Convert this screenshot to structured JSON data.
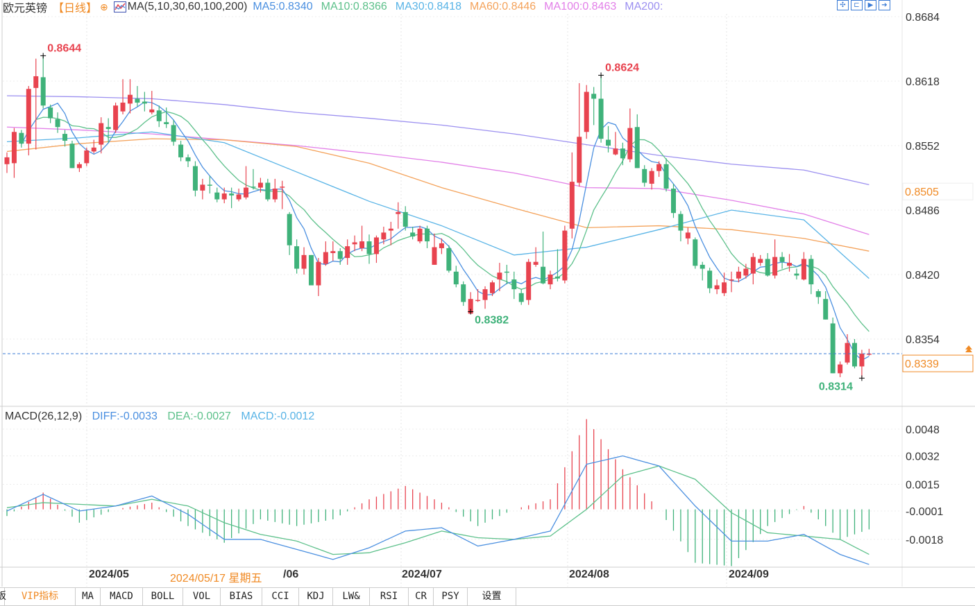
{
  "header": {
    "symbol": "欧元英镑",
    "period": "【日线】",
    "ma_params": "MA(5,10,30,60,100,200)",
    "ma_values": [
      {
        "label": "MA5:0.8340",
        "color": "#4a8fe0"
      },
      {
        "label": "MA10:0.8366",
        "color": "#5cc08a"
      },
      {
        "label": "MA30:0.8418",
        "color": "#57b3e6"
      },
      {
        "label": "MA60:0.8446",
        "color": "#f4a25a"
      },
      {
        "label": "MA100:0.8463",
        "color": "#e27ee8"
      },
      {
        "label": "MA200:",
        "color": "#9b8ff0"
      }
    ]
  },
  "toolbar": [
    "crosshair-icon",
    "zoom-in-icon",
    "play-icon",
    "exit-icon"
  ],
  "macd_header": {
    "title": "MACD(26,12,9)",
    "diff": "DIFF:-0.0033",
    "dea": "DEA:-0.0027",
    "macd": "MACD:-0.0012"
  },
  "x_axis": {
    "labels": [
      "2024/05",
      "/06",
      "2024/07",
      "2024/08",
      "2024/09"
    ],
    "crosshair_date": "2024/05/17 星期五"
  },
  "tabs": [
    "板",
    "VIP指标",
    "MA",
    "MACD",
    "BOLL",
    "VOL",
    "BIAS",
    "CCI",
    "KDJ",
    "LW&",
    "RSI",
    "CR",
    "PSY",
    "设置"
  ],
  "colors": {
    "up": "#e8434f",
    "down": "#3fb27a",
    "last_price_line": "#3a7bd5",
    "accent": "#f08a24"
  },
  "chart_data": [
    {
      "type": "candlestick",
      "y_ticks": [
        "0.8684",
        "0.8618",
        "0.8552",
        "0.8486",
        "0.8420",
        "0.8354"
      ],
      "ylim": [
        0.8284,
        0.8684
      ],
      "crosshair_price": "0.8505",
      "last_price": "0.8339",
      "annotations": [
        {
          "label": "0.8644",
          "index": 5,
          "price": 0.8644,
          "kind": "high"
        },
        {
          "label": "0.8624",
          "index": 82,
          "price": 0.8624,
          "kind": "high"
        },
        {
          "label": "0.8382",
          "index": 64,
          "price": 0.8382,
          "kind": "low"
        },
        {
          "label": "0.8314",
          "index": 118,
          "price": 0.8314,
          "kind": "low"
        }
      ],
      "ohlc": [
        [
          0.8533,
          0.8545,
          0.8524,
          0.854
        ],
        [
          0.8534,
          0.857,
          0.8519,
          0.8566
        ],
        [
          0.8565,
          0.8568,
          0.855,
          0.8554
        ],
        [
          0.8554,
          0.8613,
          0.8542,
          0.861
        ],
        [
          0.8611,
          0.8641,
          0.8548,
          0.8623
        ],
        [
          0.8622,
          0.8644,
          0.859,
          0.8593
        ],
        [
          0.8591,
          0.8594,
          0.8575,
          0.858
        ],
        [
          0.8579,
          0.8586,
          0.8565,
          0.8571
        ],
        [
          0.8564,
          0.8568,
          0.8551,
          0.8557
        ],
        [
          0.8554,
          0.8557,
          0.8529,
          0.8529
        ],
        [
          0.8529,
          0.8535,
          0.8525,
          0.8533
        ],
        [
          0.8534,
          0.855,
          0.8531,
          0.8547
        ],
        [
          0.8546,
          0.8558,
          0.8544,
          0.855
        ],
        [
          0.8553,
          0.8581,
          0.8544,
          0.8575
        ],
        [
          0.8571,
          0.858,
          0.8555,
          0.8569
        ],
        [
          0.8568,
          0.8596,
          0.8565,
          0.8593
        ],
        [
          0.8587,
          0.862,
          0.8584,
          0.8596
        ],
        [
          0.8595,
          0.862,
          0.8585,
          0.8604
        ],
        [
          0.86,
          0.8613,
          0.8592,
          0.8596
        ],
        [
          0.8597,
          0.8607,
          0.8587,
          0.8595
        ],
        [
          0.8586,
          0.8608,
          0.8584,
          0.8589
        ],
        [
          0.8588,
          0.8593,
          0.8571,
          0.8577
        ],
        [
          0.8576,
          0.8591,
          0.857,
          0.8574
        ],
        [
          0.8573,
          0.8578,
          0.8552,
          0.8556
        ],
        [
          0.8553,
          0.8557,
          0.8536,
          0.854
        ],
        [
          0.854,
          0.8543,
          0.853,
          0.8536
        ],
        [
          0.8531,
          0.8536,
          0.85,
          0.8506
        ],
        [
          0.8506,
          0.8518,
          0.8497,
          0.8512
        ],
        [
          0.8512,
          0.8521,
          0.8503,
          0.8511
        ],
        [
          0.8504,
          0.8509,
          0.8494,
          0.8497
        ],
        [
          0.8497,
          0.8509,
          0.8493,
          0.8503
        ],
        [
          0.8503,
          0.8509,
          0.8488,
          0.8501
        ],
        [
          0.8497,
          0.8508,
          0.8495,
          0.8502
        ],
        [
          0.8499,
          0.8531,
          0.8497,
          0.8509
        ],
        [
          0.851,
          0.8528,
          0.8507,
          0.8509
        ],
        [
          0.8509,
          0.8519,
          0.8504,
          0.8514
        ],
        [
          0.8514,
          0.8518,
          0.8495,
          0.8497
        ],
        [
          0.8497,
          0.8518,
          0.8494,
          0.8508
        ],
        [
          0.8509,
          0.8516,
          0.8487,
          0.851
        ],
        [
          0.8482,
          0.8484,
          0.844,
          0.845
        ],
        [
          0.8449,
          0.8456,
          0.8421,
          0.8426
        ],
        [
          0.8426,
          0.8448,
          0.842,
          0.844
        ],
        [
          0.844,
          0.844,
          0.8409,
          0.8409
        ],
        [
          0.8409,
          0.8437,
          0.8398,
          0.8433
        ],
        [
          0.8431,
          0.8454,
          0.8429,
          0.8443
        ],
        [
          0.8442,
          0.8454,
          0.8434,
          0.8444
        ],
        [
          0.8444,
          0.8447,
          0.843,
          0.8436
        ],
        [
          0.8437,
          0.8456,
          0.843,
          0.8449
        ],
        [
          0.8451,
          0.846,
          0.8444,
          0.8453
        ],
        [
          0.8447,
          0.847,
          0.8444,
          0.8454
        ],
        [
          0.8454,
          0.8461,
          0.8431,
          0.8441
        ],
        [
          0.8441,
          0.846,
          0.8432,
          0.8458
        ],
        [
          0.8456,
          0.8469,
          0.8451,
          0.8463
        ],
        [
          0.8465,
          0.8474,
          0.845,
          0.8467
        ],
        [
          0.8482,
          0.8494,
          0.8467,
          0.8484
        ],
        [
          0.8484,
          0.849,
          0.8465,
          0.8469
        ],
        [
          0.8463,
          0.8469,
          0.8456,
          0.8459
        ],
        [
          0.8454,
          0.847,
          0.8452,
          0.8467
        ],
        [
          0.8467,
          0.847,
          0.8447,
          0.8454
        ],
        [
          0.843,
          0.8462,
          0.843,
          0.8448
        ],
        [
          0.8447,
          0.8457,
          0.8441,
          0.8452
        ],
        [
          0.8447,
          0.845,
          0.8422,
          0.8424
        ],
        [
          0.8423,
          0.8429,
          0.8407,
          0.841
        ],
        [
          0.841,
          0.8413,
          0.8388,
          0.8392
        ],
        [
          0.838,
          0.8402,
          0.8382,
          0.8395
        ],
        [
          0.8393,
          0.8405,
          0.8392,
          0.8394
        ],
        [
          0.8394,
          0.8408,
          0.8385,
          0.8405
        ],
        [
          0.8401,
          0.8414,
          0.8398,
          0.8412
        ],
        [
          0.8415,
          0.8432,
          0.8403,
          0.8422
        ],
        [
          0.8423,
          0.843,
          0.841,
          0.8422
        ],
        [
          0.8415,
          0.8423,
          0.8395,
          0.8405
        ],
        [
          0.8401,
          0.8405,
          0.8389,
          0.8392
        ],
        [
          0.8394,
          0.8436,
          0.8389,
          0.8433
        ],
        [
          0.843,
          0.8448,
          0.8428,
          0.8433
        ],
        [
          0.8428,
          0.8464,
          0.841,
          0.8411
        ],
        [
          0.841,
          0.8424,
          0.8405,
          0.842
        ],
        [
          0.8418,
          0.8446,
          0.8413,
          0.8416
        ],
        [
          0.8414,
          0.847,
          0.8411,
          0.8465
        ],
        [
          0.8467,
          0.8545,
          0.8457,
          0.8515
        ],
        [
          0.8514,
          0.8616,
          0.851,
          0.8561
        ],
        [
          0.8566,
          0.8614,
          0.8559,
          0.8607
        ],
        [
          0.8605,
          0.8612,
          0.8573,
          0.86
        ],
        [
          0.86,
          0.8624,
          0.8555,
          0.8559
        ],
        [
          0.8558,
          0.8572,
          0.8545,
          0.8552
        ],
        [
          0.8543,
          0.8566,
          0.8542,
          0.8549
        ],
        [
          0.8549,
          0.8555,
          0.8532,
          0.8539
        ],
        [
          0.8538,
          0.859,
          0.8535,
          0.857
        ],
        [
          0.8571,
          0.8584,
          0.8529,
          0.8529
        ],
        [
          0.8528,
          0.8532,
          0.851,
          0.8514
        ],
        [
          0.8513,
          0.8529,
          0.8507,
          0.8526
        ],
        [
          0.8526,
          0.8536,
          0.852,
          0.8533
        ],
        [
          0.8533,
          0.8539,
          0.8505,
          0.8508
        ],
        [
          0.8508,
          0.8513,
          0.8478,
          0.8483
        ],
        [
          0.8482,
          0.8485,
          0.8454,
          0.8465
        ],
        [
          0.8457,
          0.8468,
          0.8451,
          0.8463
        ],
        [
          0.8456,
          0.8458,
          0.8426,
          0.8429
        ],
        [
          0.843,
          0.8433,
          0.8414,
          0.8426
        ],
        [
          0.8424,
          0.8427,
          0.8401,
          0.8406
        ],
        [
          0.8405,
          0.8415,
          0.84,
          0.8409
        ],
        [
          0.8401,
          0.8422,
          0.8398,
          0.8412
        ],
        [
          0.8414,
          0.8423,
          0.8402,
          0.8415
        ],
        [
          0.8416,
          0.8428,
          0.8412,
          0.8423
        ],
        [
          0.8419,
          0.8431,
          0.8416,
          0.8426
        ],
        [
          0.8421,
          0.8442,
          0.841,
          0.8438
        ],
        [
          0.8432,
          0.844,
          0.8429,
          0.8436
        ],
        [
          0.8436,
          0.8442,
          0.8418,
          0.8419
        ],
        [
          0.8419,
          0.8456,
          0.8416,
          0.8438
        ],
        [
          0.8438,
          0.8443,
          0.8426,
          0.8433
        ],
        [
          0.8429,
          0.8441,
          0.8423,
          0.8432
        ],
        [
          0.8421,
          0.8426,
          0.8415,
          0.8419
        ],
        [
          0.8415,
          0.8443,
          0.8414,
          0.8436
        ],
        [
          0.8436,
          0.844,
          0.84,
          0.841
        ],
        [
          0.8403,
          0.8405,
          0.839,
          0.8397
        ],
        [
          0.8395,
          0.8403,
          0.8374,
          0.8374
        ],
        [
          0.837,
          0.8376,
          0.8319,
          0.8319
        ],
        [
          0.8319,
          0.8331,
          0.8315,
          0.8328
        ],
        [
          0.833,
          0.8359,
          0.8328,
          0.835
        ],
        [
          0.835,
          0.8354,
          0.8324,
          0.8326
        ],
        [
          0.8326,
          0.8343,
          0.8314,
          0.8339
        ],
        [
          0.8338,
          0.8344,
          0.8337,
          0.8339
        ]
      ],
      "ma_series_sampled_every_10": {
        "MA30": [
          0.8556,
          0.856,
          0.8566,
          0.8555,
          0.8525,
          0.8495,
          0.847,
          0.844,
          0.8448,
          0.8466,
          0.8486,
          0.8476,
          0.8416
        ],
        "MA60": [
          0.8546,
          0.8554,
          0.8559,
          0.8558,
          0.8551,
          0.8534,
          0.8509,
          0.8488,
          0.8468,
          0.847,
          0.8466,
          0.8457,
          0.8444
        ],
        "MA100": [
          0.8571,
          0.8568,
          0.8564,
          0.8558,
          0.8552,
          0.8544,
          0.8535,
          0.8524,
          0.8509,
          0.8508,
          0.8496,
          0.8482,
          0.8461
        ],
        "MA200": [
          0.8603,
          0.8602,
          0.86,
          0.8594,
          0.8586,
          0.858,
          0.8573,
          0.8564,
          0.8553,
          0.8542,
          0.8533,
          0.8527,
          0.8512
        ]
      }
    },
    {
      "type": "macd",
      "y_ticks": [
        "0.0048",
        "0.0032",
        "0.0015",
        "-0.0001",
        "-0.0018"
      ],
      "sampled_every_5": {
        "DIFF": [
          -0.0001,
          0.0009,
          -0.0001,
          0.0002,
          0.0008,
          -0.0003,
          -0.0018,
          -0.0018,
          -0.0024,
          -0.003,
          -0.0023,
          -0.0013,
          -0.0011,
          -0.0022,
          -0.0018,
          -0.0013,
          0.0027,
          0.0032,
          0.0026,
          0.0002,
          -0.0019,
          -0.0019,
          -0.0015,
          -0.0027,
          -0.0033
        ],
        "DEA": [
          0.0001,
          0.0004,
          0.0003,
          0.0002,
          0.0006,
          0.0002,
          -0.0008,
          -0.0015,
          -0.0019,
          -0.0027,
          -0.0026,
          -0.002,
          -0.0013,
          -0.0017,
          -0.0018,
          -0.0016,
          0.0,
          0.002,
          0.0026,
          0.0018,
          -0.0002,
          -0.0014,
          -0.0016,
          -0.0018,
          -0.0027
        ]
      }
    }
  ]
}
